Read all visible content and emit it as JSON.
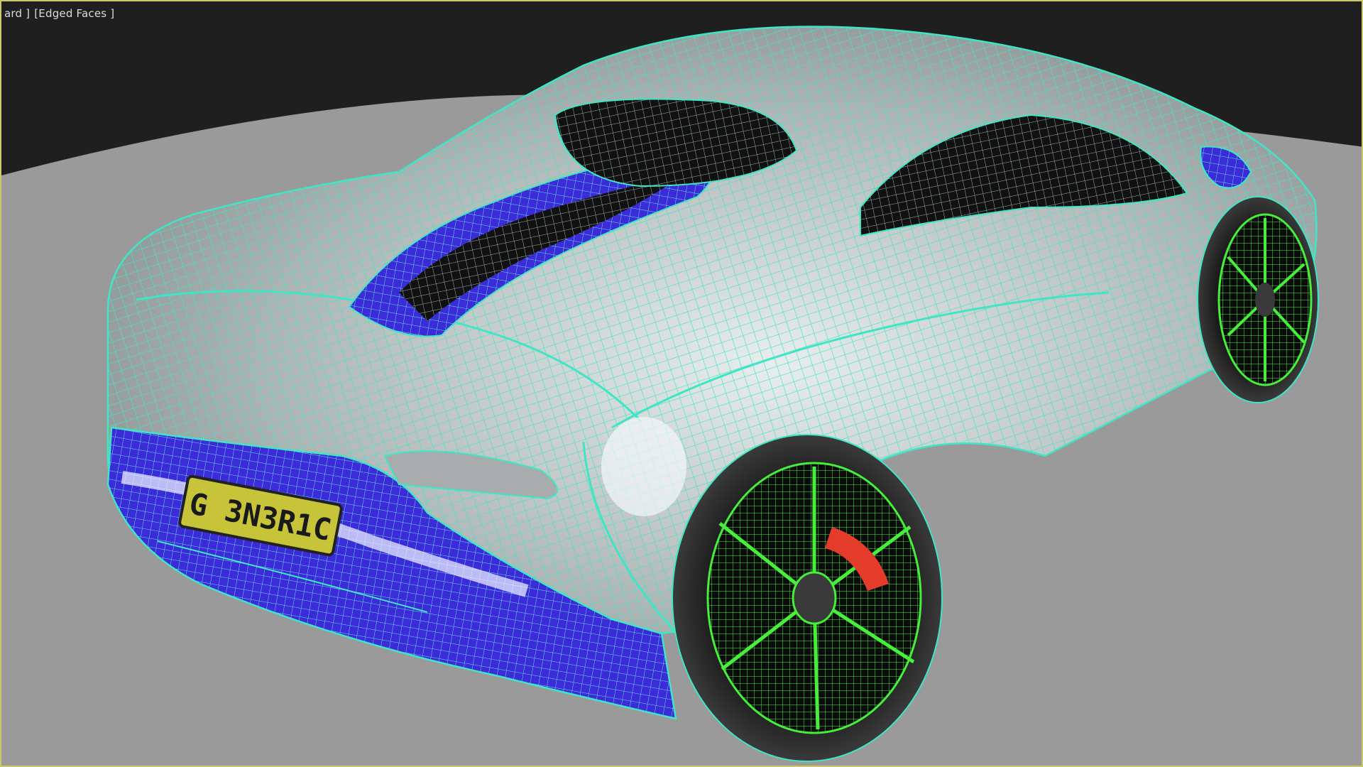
{
  "viewport": {
    "label_prefix": "ard ]",
    "shading_mode": "[Edged Faces ]",
    "background_color": "#1f1f1f",
    "ground_color": "#9a9a9a",
    "border_color": "#c9c96a"
  },
  "scene": {
    "license_plate": "G 3N3R1C",
    "colors": {
      "body_wire": "#3fe6c6",
      "body_shade": "#b9bdbd",
      "trim": "#3b2bd8",
      "wheel_wire": "#45ef3a",
      "plate_bg": "#c8c43a",
      "caliper": "#e43b2a"
    }
  }
}
